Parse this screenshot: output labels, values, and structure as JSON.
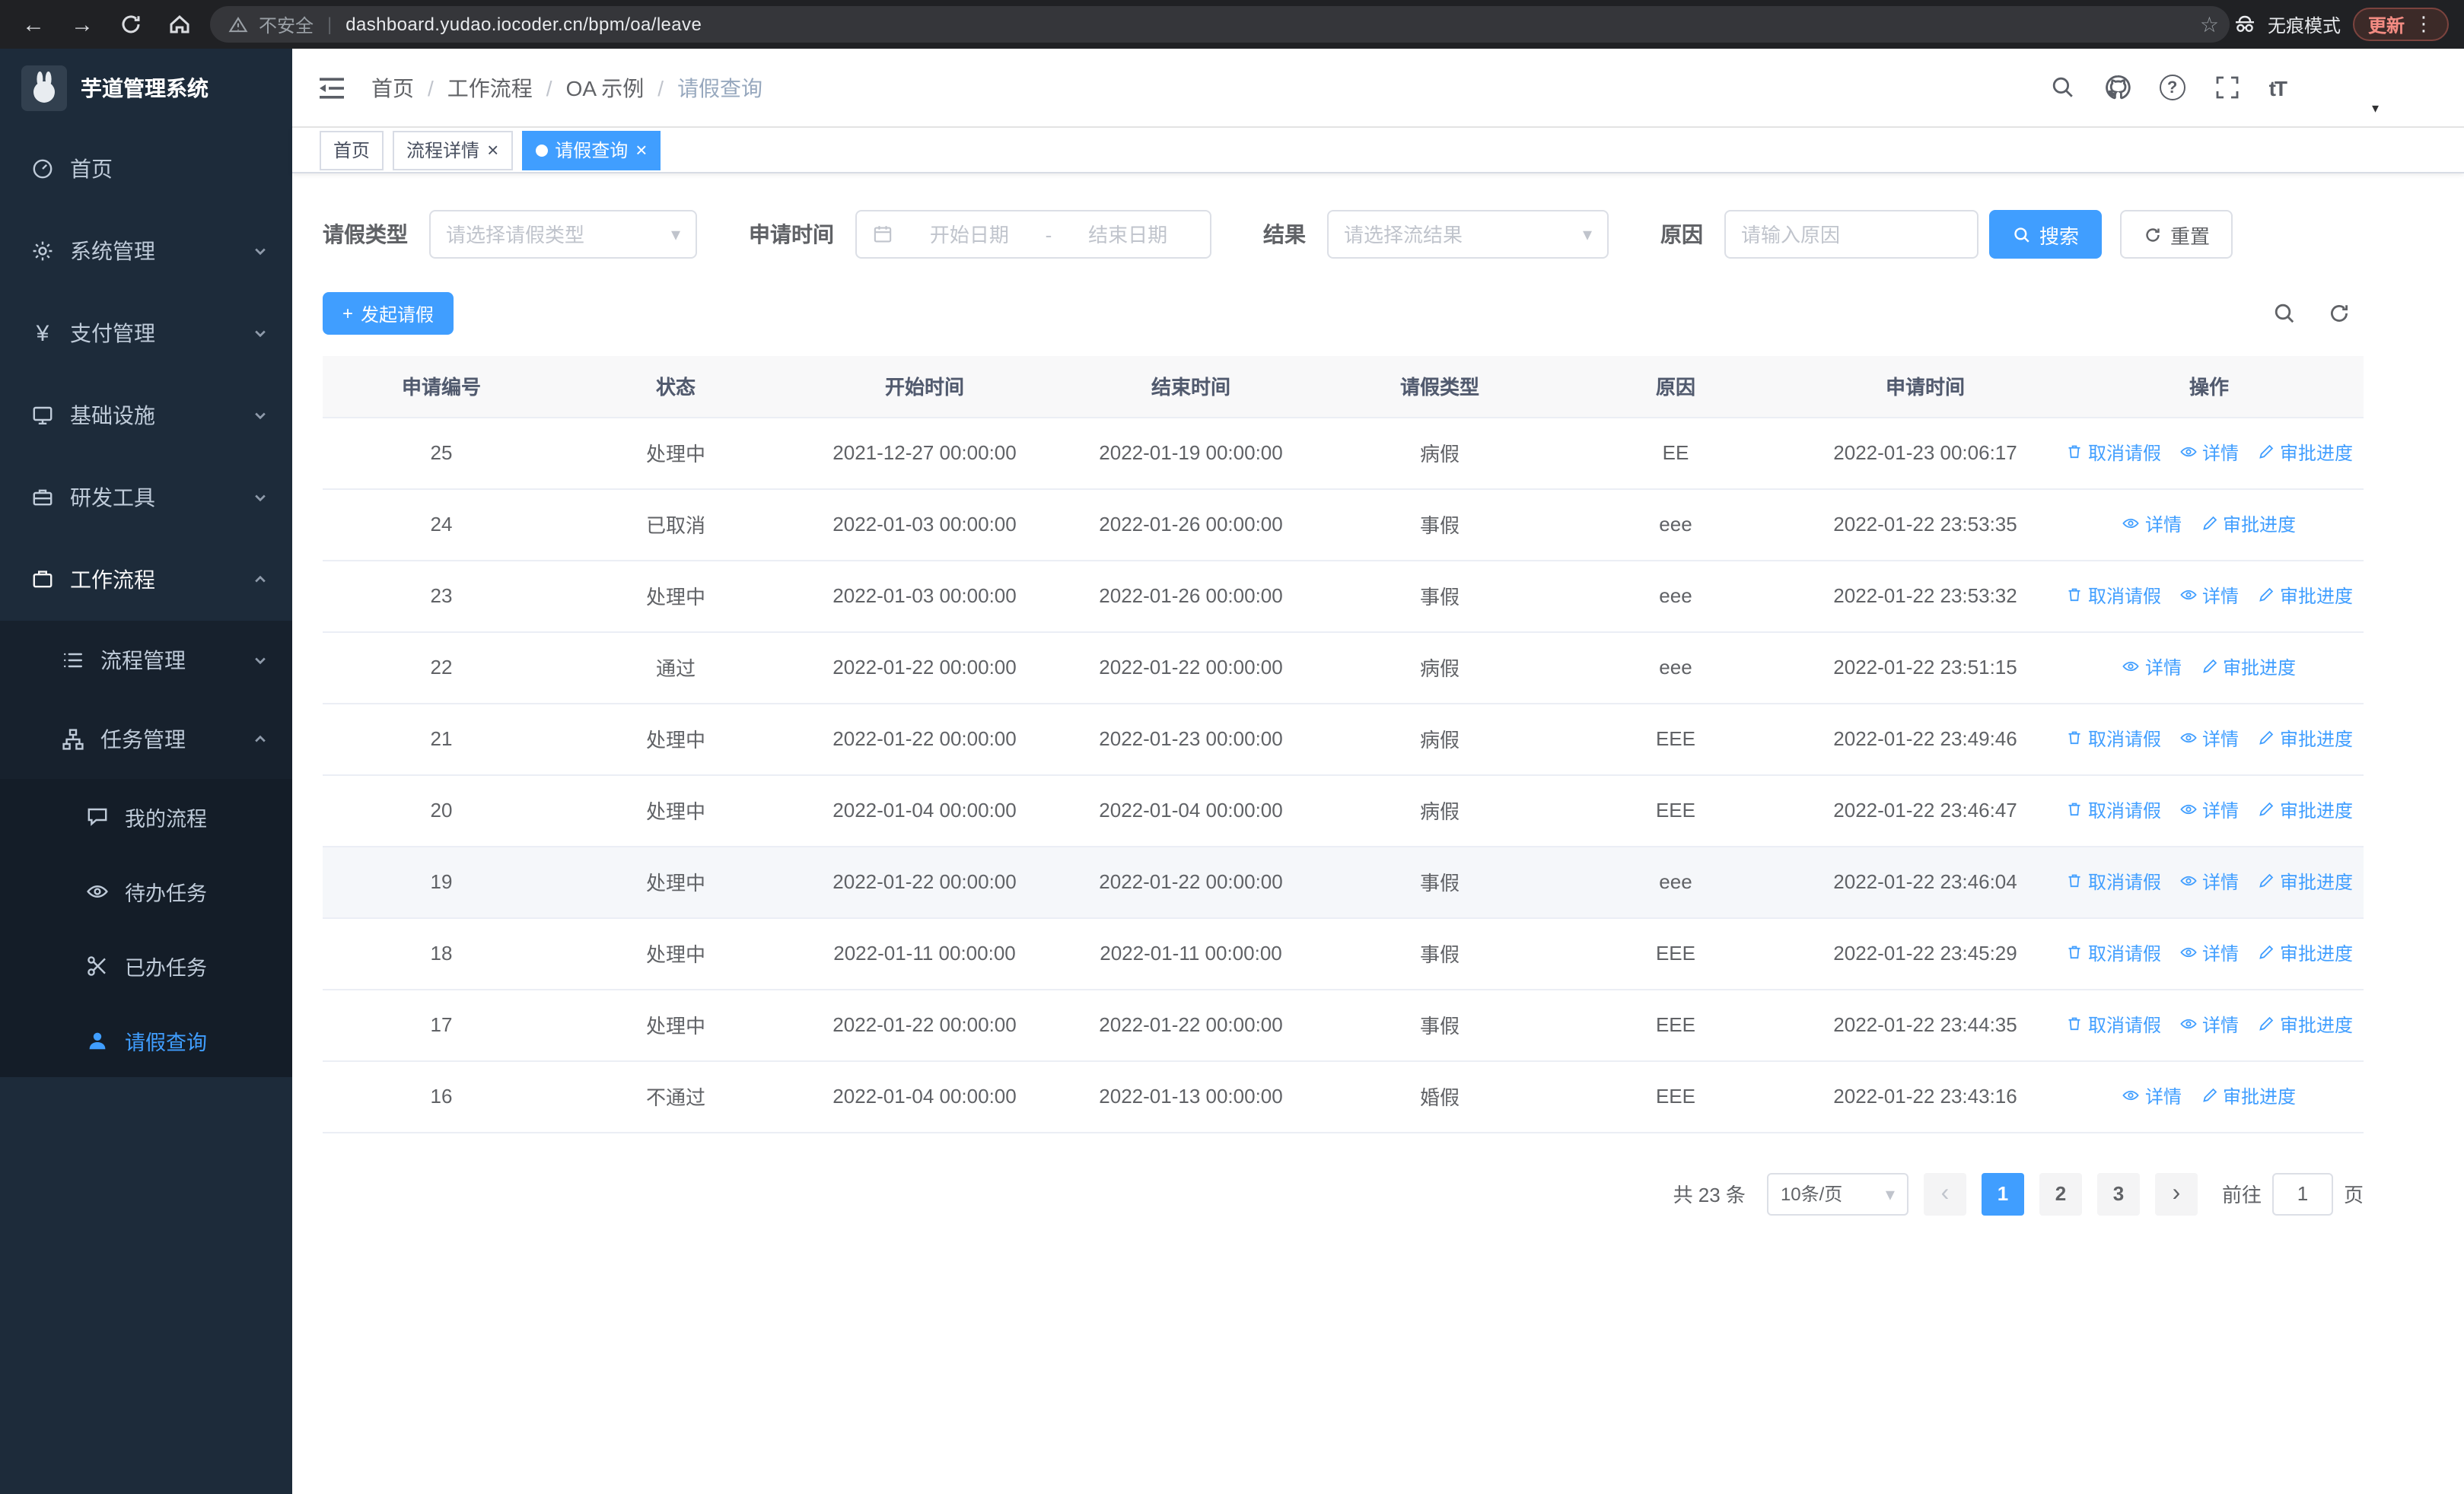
{
  "colors": {
    "primary": "#409eff",
    "sidebar_bg": "#1d2b3a",
    "chrome_bg": "#202124"
  },
  "icons": {
    "back": "←",
    "forward": "→",
    "star": "☆",
    "menu_dots": "⋮",
    "close_tab": "×",
    "active_tab_dot": "●",
    "chevron": "▾",
    "prev": "‹",
    "next": "›",
    "plus": "+",
    "help": "?",
    "font_size": "tT",
    "yen": "¥"
  },
  "browser": {
    "warning": "不安全",
    "url": "dashboard.yudao.iocoder.cn/bpm/oa/leave",
    "incognito": "无痕模式",
    "update": "更新"
  },
  "sidebar": {
    "logo_title": "芋道管理系统",
    "menu": [
      {
        "label": "首页"
      },
      {
        "label": "系统管理"
      },
      {
        "label": "支付管理"
      },
      {
        "label": "基础设施"
      },
      {
        "label": "研发工具"
      },
      {
        "label": "工作流程"
      }
    ],
    "workflow_submenu": [
      {
        "label": "流程管理"
      },
      {
        "label": "任务管理"
      }
    ],
    "task_children": [
      {
        "label": "我的流程"
      },
      {
        "label": "待办任务"
      },
      {
        "label": "已办任务"
      },
      {
        "label": "请假查询",
        "active": true
      }
    ]
  },
  "header": {
    "breadcrumb": [
      "首页",
      "工作流程",
      "OA 示例",
      "请假查询"
    ]
  },
  "tabs": [
    {
      "label": "首页",
      "closable": false,
      "active": false
    },
    {
      "label": "流程详情",
      "closable": true,
      "active": false
    },
    {
      "label": "请假查询",
      "closable": true,
      "active": true
    }
  ],
  "filters": {
    "leave_type_label": "请假类型",
    "leave_type_placeholder": "请选择请假类型",
    "apply_time_label": "申请时间",
    "start_date_placeholder": "开始日期",
    "range_separator": "-",
    "end_date_placeholder": "结束日期",
    "result_label": "结果",
    "result_placeholder": "请选择流结果",
    "reason_label": "原因",
    "reason_placeholder": "请输入原因",
    "search_button": "搜索",
    "reset_button": "重置"
  },
  "toolbar": {
    "create_button": "发起请假"
  },
  "table": {
    "columns": [
      "申请编号",
      "状态",
      "开始时间",
      "结束时间",
      "请假类型",
      "原因",
      "申请时间",
      "操作"
    ],
    "action_labels": {
      "cancel": "取消请假",
      "detail": "详情",
      "progress": "审批进度"
    },
    "rows": [
      {
        "id": "25",
        "status": "处理中",
        "start": "2021-12-27 00:00:00",
        "end": "2022-01-19 00:00:00",
        "type": "病假",
        "reason": "EE",
        "applied": "2022-01-23 00:06:17",
        "actions": [
          "cancel",
          "detail",
          "progress"
        ]
      },
      {
        "id": "24",
        "status": "已取消",
        "start": "2022-01-03 00:00:00",
        "end": "2022-01-26 00:00:00",
        "type": "事假",
        "reason": "eee",
        "applied": "2022-01-22 23:53:35",
        "actions": [
          "detail",
          "progress"
        ]
      },
      {
        "id": "23",
        "status": "处理中",
        "start": "2022-01-03 00:00:00",
        "end": "2022-01-26 00:00:00",
        "type": "事假",
        "reason": "eee",
        "applied": "2022-01-22 23:53:32",
        "actions": [
          "cancel",
          "detail",
          "progress"
        ]
      },
      {
        "id": "22",
        "status": "通过",
        "start": "2022-01-22 00:00:00",
        "end": "2022-01-22 00:00:00",
        "type": "病假",
        "reason": "eee",
        "applied": "2022-01-22 23:51:15",
        "actions": [
          "detail",
          "progress"
        ]
      },
      {
        "id": "21",
        "status": "处理中",
        "start": "2022-01-22 00:00:00",
        "end": "2022-01-23 00:00:00",
        "type": "病假",
        "reason": "EEE",
        "applied": "2022-01-22 23:49:46",
        "actions": [
          "cancel",
          "detail",
          "progress"
        ]
      },
      {
        "id": "20",
        "status": "处理中",
        "start": "2022-01-04 00:00:00",
        "end": "2022-01-04 00:00:00",
        "type": "病假",
        "reason": "EEE",
        "applied": "2022-01-22 23:46:47",
        "actions": [
          "cancel",
          "detail",
          "progress"
        ]
      },
      {
        "id": "19",
        "status": "处理中",
        "start": "2022-01-22 00:00:00",
        "end": "2022-01-22 00:00:00",
        "type": "事假",
        "reason": "eee",
        "applied": "2022-01-22 23:46:04",
        "actions": [
          "cancel",
          "detail",
          "progress"
        ],
        "highlighted": true
      },
      {
        "id": "18",
        "status": "处理中",
        "start": "2022-01-11 00:00:00",
        "end": "2022-01-11 00:00:00",
        "type": "事假",
        "reason": "EEE",
        "applied": "2022-01-22 23:45:29",
        "actions": [
          "cancel",
          "detail",
          "progress"
        ]
      },
      {
        "id": "17",
        "status": "处理中",
        "start": "2022-01-22 00:00:00",
        "end": "2022-01-22 00:00:00",
        "type": "事假",
        "reason": "EEE",
        "applied": "2022-01-22 23:44:35",
        "actions": [
          "cancel",
          "detail",
          "progress"
        ]
      },
      {
        "id": "16",
        "status": "不通过",
        "start": "2022-01-04 00:00:00",
        "end": "2022-01-13 00:00:00",
        "type": "婚假",
        "reason": "EEE",
        "applied": "2022-01-22 23:43:16",
        "actions": [
          "detail",
          "progress"
        ]
      }
    ]
  },
  "pagination": {
    "total": "共 23 条",
    "page_size": "10条/页",
    "pages": [
      "1",
      "2",
      "3"
    ],
    "active_page": "1",
    "goto_label": "前往",
    "goto_value": "1",
    "goto_suffix": "页"
  }
}
